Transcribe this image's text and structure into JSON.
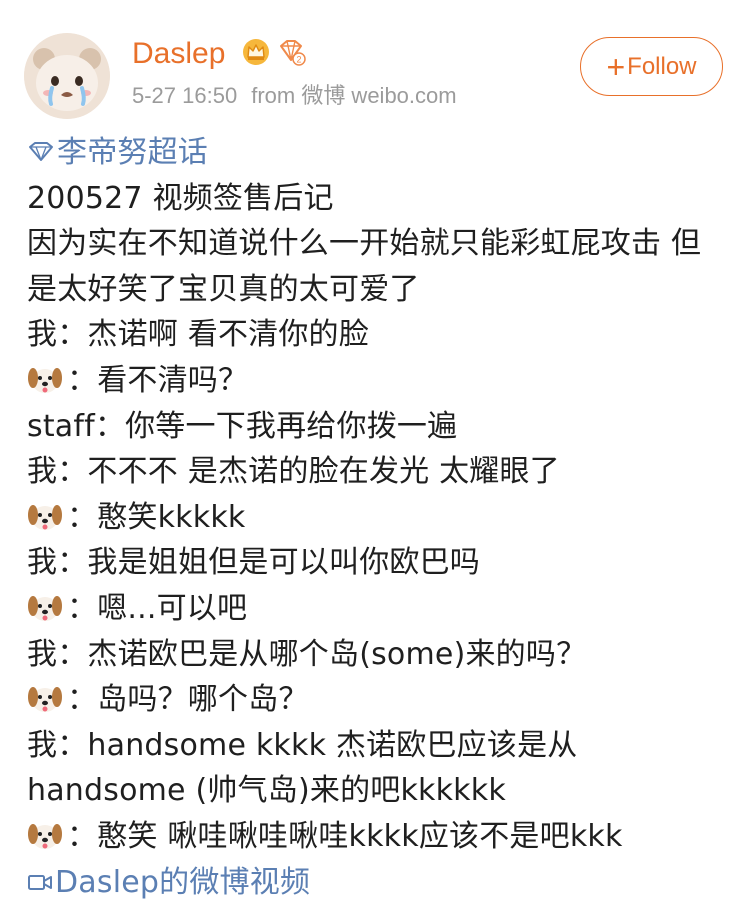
{
  "post": {
    "author": {
      "name": "Daslep",
      "avatar_icon": "avatar-bear-icon"
    },
    "date": "5-27 16:50",
    "source": "from 微博 weibo.com",
    "follow_label": "Follow",
    "topic": "李帝努超话",
    "video_link": "Daslep的微博视频",
    "lines": [
      {
        "speaker": "",
        "text": "200527 视频签售后记"
      },
      {
        "speaker": "",
        "text": "因为实在不知道说什么一开始就只能彩虹屁攻击 但是太好笑了宝贝真的太可爱了"
      },
      {
        "speaker": "我",
        "text": "：杰诺啊 看不清你的脸"
      },
      {
        "speaker": "dog-emoji",
        "text": "：看不清吗？"
      },
      {
        "speaker": "staff",
        "text": "：你等一下我再给你拨一遍"
      },
      {
        "speaker": "我",
        "text": "：不不不 是杰诺的脸在发光 太耀眼了"
      },
      {
        "speaker": "dog-emoji",
        "text": "：憨笑kkkkk"
      },
      {
        "speaker": "我",
        "text": "：我是姐姐但是可以叫你欧巴吗"
      },
      {
        "speaker": "dog-emoji",
        "text": "：嗯...可以吧"
      },
      {
        "speaker": "我",
        "text": "：杰诺欧巴是从哪个岛(some)来的吗？"
      },
      {
        "speaker": "dog-emoji",
        "text": "：岛吗？哪个岛？"
      },
      {
        "speaker": "我",
        "text": "：handsome kkkk 杰诺欧巴应该是从handsome (帅气岛)来的吧kkkkkk"
      },
      {
        "speaker": "dog-emoji",
        "text": "：憨笑 啾哇啾哇啾哇kkkk应该不是吧kkk"
      }
    ]
  },
  "colors": {
    "accent": "#e8702a",
    "link": "#5b7fb3",
    "meta": "#9b9b9b"
  }
}
